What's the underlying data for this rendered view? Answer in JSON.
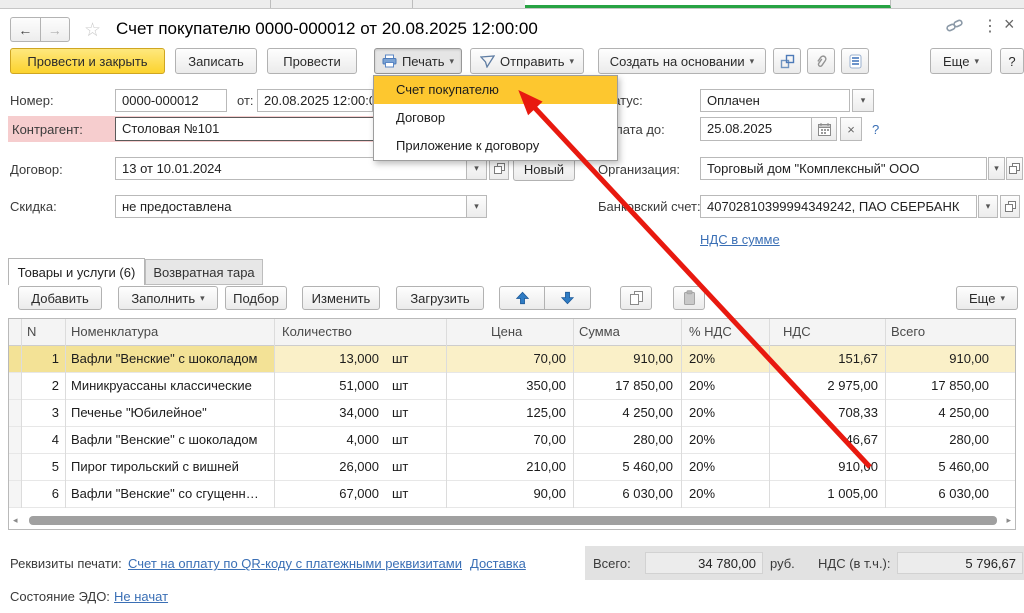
{
  "titlebar": {
    "title": "Счет покупателю 0000-000012 от 20.08.2025 12:00:00"
  },
  "toolbar": {
    "post_and_close": "Провести и закрыть",
    "write": "Записать",
    "post": "Провести",
    "print": "Печать",
    "send": "Отправить",
    "create_on_basis": "Создать на основании",
    "more": "Еще",
    "help": "?"
  },
  "print_menu": {
    "items": [
      "Счет покупателю",
      "Договор",
      "Приложение к договору"
    ],
    "highlighted": "Счет покупателю"
  },
  "fields": {
    "number": {
      "label": "Номер:",
      "value": "0000-000012"
    },
    "date": {
      "label": "от:",
      "value": "20.08.2025 12:00:00"
    },
    "counterparty": {
      "label": "Контрагент:",
      "value": "Столовая №101"
    },
    "contract": {
      "label": "Договор:",
      "value": "13 от 10.01.2024",
      "new_button": "Новый"
    },
    "discount": {
      "label": "Скидка:",
      "value": "не предоставлена"
    },
    "status": {
      "label": "Статус:",
      "value": "Оплачен"
    },
    "pay_until": {
      "label": "Оплата до:",
      "value": "25.08.2025",
      "help": "?"
    },
    "organization": {
      "label": "Организация:",
      "value": "Торговый дом \"Комплексный\" ООО"
    },
    "bank_account": {
      "label": "Банковский счет:",
      "value": "40702810399994349242, ПАО СБЕРБАНК"
    },
    "vat_mode_link": "НДС в сумме"
  },
  "section_tabs": [
    {
      "label": "Товары и услуги (6)",
      "active": true
    },
    {
      "label": "Возвратная тара",
      "active": false
    }
  ],
  "table_toolbar": {
    "add": "Добавить",
    "fill": "Заполнить",
    "pick": "Подбор",
    "edit": "Изменить",
    "load": "Загрузить",
    "more": "Еще"
  },
  "table": {
    "columns": [
      "N",
      "Номенклатура",
      "Количество",
      "Цена",
      "Сумма",
      "% НДС",
      "НДС",
      "Всего"
    ],
    "rows": [
      {
        "n": "1",
        "name": "Вафли \"Венские\" с шоколадом",
        "qty": "13,000",
        "unit": "шт",
        "price": "70,00",
        "sum": "910,00",
        "vat_rate": "20%",
        "vat": "151,67",
        "total": "910,00",
        "selected": true
      },
      {
        "n": "2",
        "name": "Миникруассаны классические",
        "qty": "51,000",
        "unit": "шт",
        "price": "350,00",
        "sum": "17 850,00",
        "vat_rate": "20%",
        "vat": "2 975,00",
        "total": "17 850,00",
        "selected": false
      },
      {
        "n": "3",
        "name": "Печенье \"Юбилейное\"",
        "qty": "34,000",
        "unit": "шт",
        "price": "125,00",
        "sum": "4 250,00",
        "vat_rate": "20%",
        "vat": "708,33",
        "total": "4 250,00",
        "selected": false
      },
      {
        "n": "4",
        "name": "Вафли \"Венские\" с шоколадом",
        "qty": "4,000",
        "unit": "шт",
        "price": "70,00",
        "sum": "280,00",
        "vat_rate": "20%",
        "vat": "46,67",
        "total": "280,00",
        "selected": false
      },
      {
        "n": "5",
        "name": "Пирог тирольский с вишней",
        "qty": "26,000",
        "unit": "шт",
        "price": "210,00",
        "sum": "5 460,00",
        "vat_rate": "20%",
        "vat": "910,00",
        "total": "5 460,00",
        "selected": false
      },
      {
        "n": "6",
        "name": "Вафли \"Венские\" со сгущенн…",
        "qty": "67,000",
        "unit": "шт",
        "price": "90,00",
        "sum": "6 030,00",
        "vat_rate": "20%",
        "vat": "1 005,00",
        "total": "6 030,00",
        "selected": false
      }
    ]
  },
  "footer": {
    "print_details_label": "Реквизиты печати:",
    "print_details_link": "Счет на оплату по QR-коду с платежными реквизитами",
    "delivery_link": "Доставка",
    "total_label": "Всего:",
    "total_value": "34 780,00",
    "currency": "руб.",
    "vat_label": "НДС (в т.ч.):",
    "vat_value": "5 796,67",
    "edo_label": "Состояние ЭДО:",
    "edo_link": "Не начат"
  },
  "icons": {
    "back": "←",
    "forward": "→",
    "favorite": "☆",
    "window_menu": "⋮",
    "close": "×",
    "dropdown": "▾",
    "clear": "×",
    "scroll_left": "◂",
    "scroll_right": "▸",
    "print": "printer",
    "send": "paper-plane",
    "structure": "structure-links",
    "attach": "paperclip",
    "report": "report-list",
    "copy": "copy-pages",
    "paste": "clipboard",
    "move_up": "arrow-up",
    "move_down": "arrow-down",
    "calendar": "calendar",
    "open": "open-in-form",
    "link": "chain"
  },
  "colors": {
    "accent_yellow": "#fcd32e",
    "menu_highlight": "#fdc72f",
    "selected_row": "#faf0c8",
    "counterparty_row_pink": "#f6cdce",
    "link_blue": "#3a6fb5",
    "active_tab_green": "#27a343",
    "arrow_red": "#e8190f"
  }
}
